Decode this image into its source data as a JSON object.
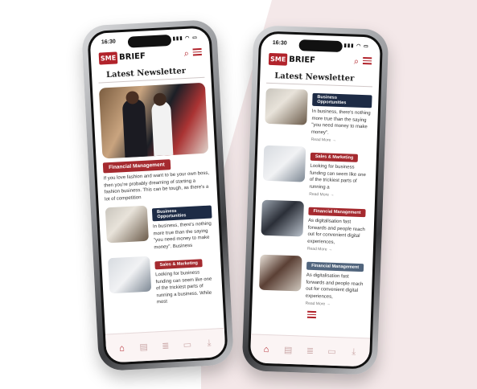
{
  "left": {
    "status_time": "16:30",
    "logo": {
      "sme": "SME",
      "brief": "BRIEF"
    },
    "title": "Latest Newsletter",
    "featured": {
      "tag": "Financial Management",
      "excerpt": "If you love fashion and want to be your own boss, then you're probably dreaming of starting a fashion business. This can be tough, as there's a lot of competition"
    },
    "items": [
      {
        "tag": "Business Opportunities",
        "excerpt": "In business, there's nothing more true than the saying \"you need money to make money\". Business"
      },
      {
        "tag": "Sales & Marketing",
        "excerpt": "Looking for business funding can seem like one of the trickiest parts of running a business. While most"
      }
    ]
  },
  "right": {
    "status_time": "16:30",
    "logo": {
      "sme": "SME",
      "brief": "BRIEF"
    },
    "title": "Latest Newsletter",
    "items": [
      {
        "tag": "Business Opportunities",
        "excerpt": "In business, there's nothing more true than the saying \"you need money to make money\".",
        "read_more": "Read More →"
      },
      {
        "tag": "Sales & Marketing",
        "excerpt": "Looking for business funding can seem like one of the trickiest parts of running a",
        "read_more": "Read More →"
      },
      {
        "tag": "Financial Management",
        "excerpt": "As digitalisation fast forwards and people reach out for convenient digital experiences,",
        "read_more": "Read More →"
      },
      {
        "tag": "Financial Management",
        "excerpt": "As digitalisation fast forwards and people reach out for convenient digital experiences,",
        "read_more": "Read More →"
      }
    ]
  },
  "icons": {
    "nav": [
      "home-icon",
      "newsletter-icon",
      "finance-icon",
      "chat-icon",
      "download-icon"
    ],
    "header": [
      "search-icon",
      "menu-icon"
    ]
  },
  "colors": {
    "brand": "#b1232b",
    "navy": "#1d2b45",
    "slate": "#51657d",
    "bg_accent": "#f4e8e9"
  }
}
